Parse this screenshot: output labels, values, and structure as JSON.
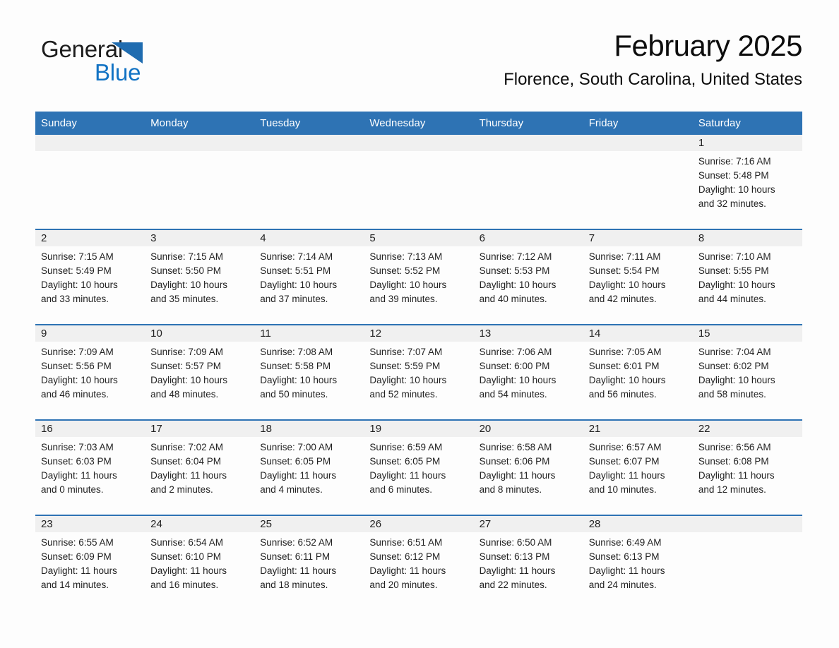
{
  "logo": {
    "line1": "General",
    "line2": "Blue",
    "triangle_color": "#1f6cb0",
    "blue_text_color": "#1273c4"
  },
  "header": {
    "title": "February 2025",
    "subtitle": "Florence, South Carolina, United States"
  },
  "colors": {
    "header_blue": "#2e73b4",
    "row_divider_blue": "#2e73b4",
    "daynum_band": "#f0f0f0",
    "page_background": "#fdfdfd",
    "text": "#222222"
  },
  "calendar": {
    "weekday_headers": [
      "Sunday",
      "Monday",
      "Tuesday",
      "Wednesday",
      "Thursday",
      "Friday",
      "Saturday"
    ],
    "labels": {
      "sunrise": "Sunrise:",
      "sunset": "Sunset:",
      "daylight": "Daylight:"
    },
    "weeks": [
      [
        {
          "day": "",
          "lines": []
        },
        {
          "day": "",
          "lines": []
        },
        {
          "day": "",
          "lines": []
        },
        {
          "day": "",
          "lines": []
        },
        {
          "day": "",
          "lines": []
        },
        {
          "day": "",
          "lines": []
        },
        {
          "day": "1",
          "lines": [
            "Sunrise: 7:16 AM",
            "Sunset: 5:48 PM",
            "Daylight: 10 hours",
            "and 32 minutes."
          ]
        }
      ],
      [
        {
          "day": "2",
          "lines": [
            "Sunrise: 7:15 AM",
            "Sunset: 5:49 PM",
            "Daylight: 10 hours",
            "and 33 minutes."
          ]
        },
        {
          "day": "3",
          "lines": [
            "Sunrise: 7:15 AM",
            "Sunset: 5:50 PM",
            "Daylight: 10 hours",
            "and 35 minutes."
          ]
        },
        {
          "day": "4",
          "lines": [
            "Sunrise: 7:14 AM",
            "Sunset: 5:51 PM",
            "Daylight: 10 hours",
            "and 37 minutes."
          ]
        },
        {
          "day": "5",
          "lines": [
            "Sunrise: 7:13 AM",
            "Sunset: 5:52 PM",
            "Daylight: 10 hours",
            "and 39 minutes."
          ]
        },
        {
          "day": "6",
          "lines": [
            "Sunrise: 7:12 AM",
            "Sunset: 5:53 PM",
            "Daylight: 10 hours",
            "and 40 minutes."
          ]
        },
        {
          "day": "7",
          "lines": [
            "Sunrise: 7:11 AM",
            "Sunset: 5:54 PM",
            "Daylight: 10 hours",
            "and 42 minutes."
          ]
        },
        {
          "day": "8",
          "lines": [
            "Sunrise: 7:10 AM",
            "Sunset: 5:55 PM",
            "Daylight: 10 hours",
            "and 44 minutes."
          ]
        }
      ],
      [
        {
          "day": "9",
          "lines": [
            "Sunrise: 7:09 AM",
            "Sunset: 5:56 PM",
            "Daylight: 10 hours",
            "and 46 minutes."
          ]
        },
        {
          "day": "10",
          "lines": [
            "Sunrise: 7:09 AM",
            "Sunset: 5:57 PM",
            "Daylight: 10 hours",
            "and 48 minutes."
          ]
        },
        {
          "day": "11",
          "lines": [
            "Sunrise: 7:08 AM",
            "Sunset: 5:58 PM",
            "Daylight: 10 hours",
            "and 50 minutes."
          ]
        },
        {
          "day": "12",
          "lines": [
            "Sunrise: 7:07 AM",
            "Sunset: 5:59 PM",
            "Daylight: 10 hours",
            "and 52 minutes."
          ]
        },
        {
          "day": "13",
          "lines": [
            "Sunrise: 7:06 AM",
            "Sunset: 6:00 PM",
            "Daylight: 10 hours",
            "and 54 minutes."
          ]
        },
        {
          "day": "14",
          "lines": [
            "Sunrise: 7:05 AM",
            "Sunset: 6:01 PM",
            "Daylight: 10 hours",
            "and 56 minutes."
          ]
        },
        {
          "day": "15",
          "lines": [
            "Sunrise: 7:04 AM",
            "Sunset: 6:02 PM",
            "Daylight: 10 hours",
            "and 58 minutes."
          ]
        }
      ],
      [
        {
          "day": "16",
          "lines": [
            "Sunrise: 7:03 AM",
            "Sunset: 6:03 PM",
            "Daylight: 11 hours",
            "and 0 minutes."
          ]
        },
        {
          "day": "17",
          "lines": [
            "Sunrise: 7:02 AM",
            "Sunset: 6:04 PM",
            "Daylight: 11 hours",
            "and 2 minutes."
          ]
        },
        {
          "day": "18",
          "lines": [
            "Sunrise: 7:00 AM",
            "Sunset: 6:05 PM",
            "Daylight: 11 hours",
            "and 4 minutes."
          ]
        },
        {
          "day": "19",
          "lines": [
            "Sunrise: 6:59 AM",
            "Sunset: 6:05 PM",
            "Daylight: 11 hours",
            "and 6 minutes."
          ]
        },
        {
          "day": "20",
          "lines": [
            "Sunrise: 6:58 AM",
            "Sunset: 6:06 PM",
            "Daylight: 11 hours",
            "and 8 minutes."
          ]
        },
        {
          "day": "21",
          "lines": [
            "Sunrise: 6:57 AM",
            "Sunset: 6:07 PM",
            "Daylight: 11 hours",
            "and 10 minutes."
          ]
        },
        {
          "day": "22",
          "lines": [
            "Sunrise: 6:56 AM",
            "Sunset: 6:08 PM",
            "Daylight: 11 hours",
            "and 12 minutes."
          ]
        }
      ],
      [
        {
          "day": "23",
          "lines": [
            "Sunrise: 6:55 AM",
            "Sunset: 6:09 PM",
            "Daylight: 11 hours",
            "and 14 minutes."
          ]
        },
        {
          "day": "24",
          "lines": [
            "Sunrise: 6:54 AM",
            "Sunset: 6:10 PM",
            "Daylight: 11 hours",
            "and 16 minutes."
          ]
        },
        {
          "day": "25",
          "lines": [
            "Sunrise: 6:52 AM",
            "Sunset: 6:11 PM",
            "Daylight: 11 hours",
            "and 18 minutes."
          ]
        },
        {
          "day": "26",
          "lines": [
            "Sunrise: 6:51 AM",
            "Sunset: 6:12 PM",
            "Daylight: 11 hours",
            "and 20 minutes."
          ]
        },
        {
          "day": "27",
          "lines": [
            "Sunrise: 6:50 AM",
            "Sunset: 6:13 PM",
            "Daylight: 11 hours",
            "and 22 minutes."
          ]
        },
        {
          "day": "28",
          "lines": [
            "Sunrise: 6:49 AM",
            "Sunset: 6:13 PM",
            "Daylight: 11 hours",
            "and 24 minutes."
          ]
        },
        {
          "day": "",
          "lines": []
        }
      ]
    ]
  }
}
